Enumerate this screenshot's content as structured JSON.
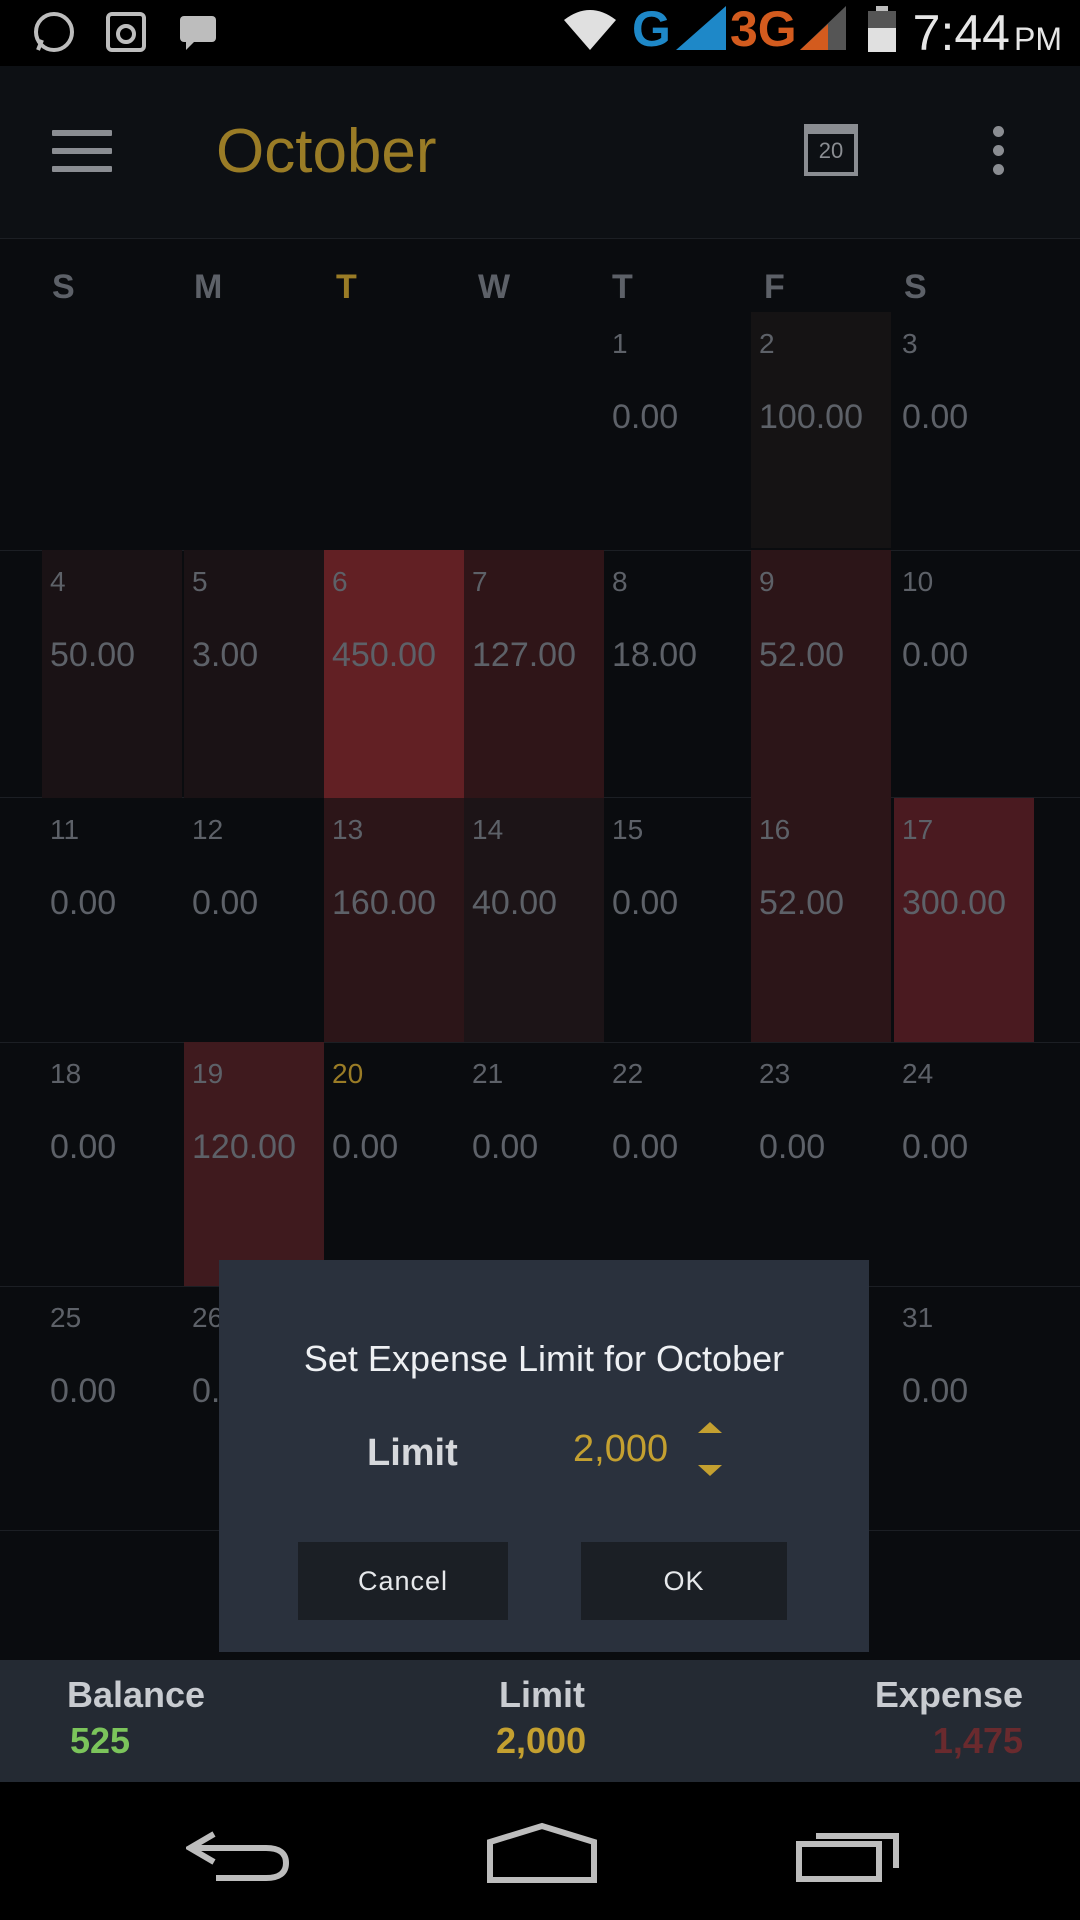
{
  "status_bar": {
    "time": "7:44",
    "ampm": "PM",
    "network_g": "G",
    "network_3g": "3G",
    "icons": [
      "whatsapp-icon",
      "instagram-icon",
      "messages-icon",
      "wifi-icon",
      "signal-icon",
      "signal-icon",
      "battery-icon"
    ]
  },
  "app_bar": {
    "title": "October",
    "today_day": "20"
  },
  "calendar": {
    "weekdays": [
      "S",
      "M",
      "T",
      "W",
      "T",
      "F",
      "S"
    ],
    "today_column": 2,
    "cells": [
      {
        "day": "1",
        "amount": "0.00"
      },
      {
        "day": "2",
        "amount": "100.00"
      },
      {
        "day": "3",
        "amount": "0.00"
      },
      {
        "day": "4",
        "amount": "50.00"
      },
      {
        "day": "5",
        "amount": "3.00"
      },
      {
        "day": "6",
        "amount": "450.00"
      },
      {
        "day": "7",
        "amount": "127.00"
      },
      {
        "day": "8",
        "amount": "18.00"
      },
      {
        "day": "9",
        "amount": "52.00"
      },
      {
        "day": "10",
        "amount": "0.00"
      },
      {
        "day": "11",
        "amount": "0.00"
      },
      {
        "day": "12",
        "amount": "0.00"
      },
      {
        "day": "13",
        "amount": "160.00"
      },
      {
        "day": "14",
        "amount": "40.00"
      },
      {
        "day": "15",
        "amount": "0.00"
      },
      {
        "day": "16",
        "amount": "52.00"
      },
      {
        "day": "17",
        "amount": "300.00"
      },
      {
        "day": "18",
        "amount": "0.00"
      },
      {
        "day": "19",
        "amount": "120.00"
      },
      {
        "day": "20",
        "amount": "0.00"
      },
      {
        "day": "21",
        "amount": "0.00"
      },
      {
        "day": "22",
        "amount": "0.00"
      },
      {
        "day": "23",
        "amount": "0.00"
      },
      {
        "day": "24",
        "amount": "0.00"
      },
      {
        "day": "25",
        "amount": "0.00"
      },
      {
        "day": "26",
        "amount": "0."
      },
      {
        "day": "31",
        "amount": "0.00"
      }
    ]
  },
  "dialog": {
    "title": "Set Expense Limit for October",
    "limit_label": "Limit",
    "limit_value": "2,000",
    "cancel_label": "Cancel",
    "ok_label": "OK"
  },
  "summary": {
    "balance_label": "Balance",
    "balance_value": "525",
    "limit_label": "Limit",
    "limit_value": "2,000",
    "expense_label": "Expense",
    "expense_value": "1,475"
  },
  "colors": {
    "accent_gold": "#9a7c26",
    "balance_green": "#7bc45b",
    "expense_red": "#6a2a2e"
  }
}
